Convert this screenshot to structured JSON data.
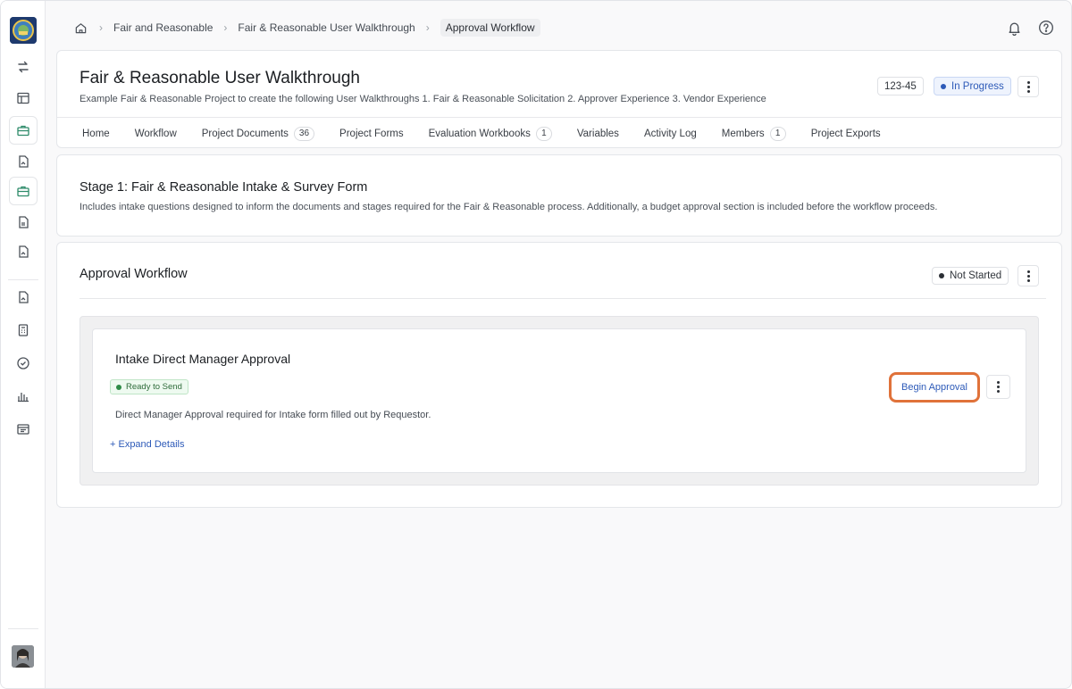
{
  "breadcrumb": {
    "items": [
      "Fair and Reasonable",
      "Fair & Reasonable User Walkthrough"
    ],
    "current": "Approval Workflow"
  },
  "project": {
    "title": "Fair & Reasonable User Walkthrough",
    "description": "Example Fair & Reasonable Project to create the following User Walkthroughs 1. Fair & Reasonable Solicitation 2. Approver Experience 3. Vendor Experience",
    "id": "123-45",
    "status": "In Progress",
    "status_color": "#2d5ab8"
  },
  "tabs": [
    {
      "label": "Home"
    },
    {
      "label": "Workflow"
    },
    {
      "label": "Project Documents",
      "count": "36"
    },
    {
      "label": "Project Forms"
    },
    {
      "label": "Evaluation Workbooks",
      "count": "1"
    },
    {
      "label": "Variables"
    },
    {
      "label": "Activity Log"
    },
    {
      "label": "Members",
      "count": "1"
    },
    {
      "label": "Project Exports"
    }
  ],
  "stage": {
    "title": "Stage 1: Fair & Reasonable Intake & Survey Form",
    "description": "Includes intake questions designed to inform the documents and stages required for the Fair & Reasonable process. Additionally, a budget approval section is included before the workflow proceeds."
  },
  "workflow": {
    "title": "Approval Workflow",
    "status": "Not Started",
    "status_color": "#2b2f35",
    "step": {
      "title": "Intake Direct Manager Approval",
      "badge": "Ready to Send",
      "badge_color": "#2e8b47",
      "description": "Direct Manager Approval required for Intake form filled out by Requestor.",
      "expand_label": "+ Expand Details",
      "action_label": "Begin Approval",
      "highlight_color": "#e0723a"
    }
  },
  "icons": [
    "swap-icon",
    "layout-icon",
    "briefcase-icon",
    "document-icon",
    "calculator-icon",
    "check-circle-icon",
    "bar-chart-icon",
    "list-icon",
    "bell-icon",
    "help-icon",
    "home-icon"
  ]
}
